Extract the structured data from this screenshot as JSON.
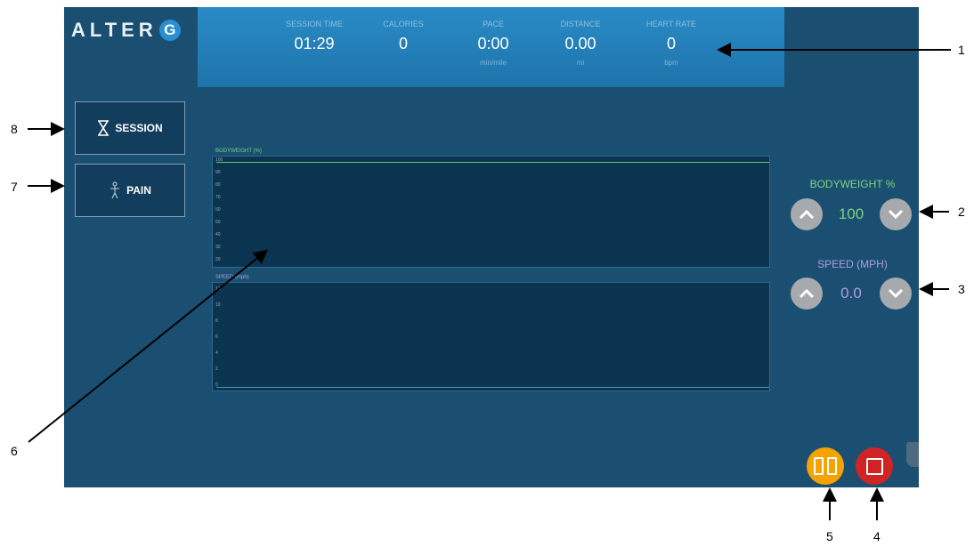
{
  "app": {
    "logo_text": "ALTER",
    "logo_g": "G"
  },
  "stats": [
    {
      "label": "SESSION TIME",
      "value": "01:29",
      "unit": ""
    },
    {
      "label": "CALORIES",
      "value": "0",
      "unit": ""
    },
    {
      "label": "PACE",
      "value": "0:00",
      "unit": "min/mile"
    },
    {
      "label": "DISTANCE",
      "value": "0.00",
      "unit": "mi"
    },
    {
      "label": "HEART RATE",
      "value": "0",
      "unit": "bpm"
    }
  ],
  "sidebar": {
    "session_label": "SESSION",
    "pain_label": "PAIN"
  },
  "charts": {
    "bodyweight_label": "BODYWEIGHT (%)",
    "bodyweight_ticks": [
      "100",
      "90",
      "80",
      "70",
      "60",
      "50",
      "40",
      "30",
      "20"
    ],
    "speed_label": "SPEED (mph)",
    "speed_ticks": [
      "12",
      "10",
      "8",
      "6",
      "4",
      "2",
      "0"
    ]
  },
  "controls": {
    "bodyweight_title": "BODYWEIGHT %",
    "bodyweight_value": "100",
    "speed_title": "SPEED (MPH)",
    "speed_value": "0.0"
  },
  "callouts": [
    "1",
    "2",
    "3",
    "4",
    "5",
    "6",
    "7",
    "8"
  ],
  "colors": {
    "screen_bg": "#1a4f72",
    "bodyweight": "#7fd27f",
    "speed": "#b49ae0",
    "pause": "#f5a300",
    "stop": "#d02424"
  }
}
